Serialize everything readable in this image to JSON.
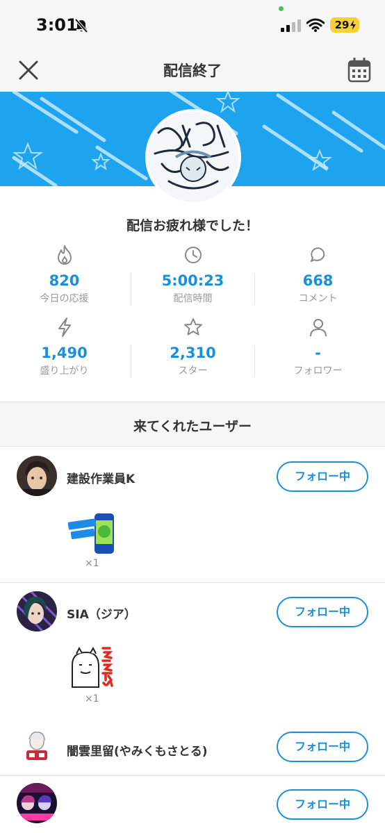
{
  "status_bar": {
    "time": "3:01",
    "battery": "29"
  },
  "nav": {
    "title": "配信終了"
  },
  "summary": {
    "greeting": "配信お疲れ様でした！"
  },
  "stats": [
    {
      "icon": "fire-icon",
      "value": "820",
      "label": "今日の応援"
    },
    {
      "icon": "clock-icon",
      "value": "5:00:23",
      "label": "配信時間"
    },
    {
      "icon": "comment-icon",
      "value": "668",
      "label": "コメント"
    },
    {
      "icon": "lightning-icon",
      "value": "1,490",
      "label": "盛り上がり"
    },
    {
      "icon": "star-icon",
      "value": "2,310",
      "label": "スター"
    },
    {
      "icon": "person-icon",
      "value": "-",
      "label": "フォロワー"
    }
  ],
  "visitors": {
    "title": "来てくれたユーザー",
    "users": [
      {
        "name": "建設作業員K",
        "follow_label": "フォロー中",
        "gift_count": "×1",
        "gift_icon": "energy-drink-can-icon"
      },
      {
        "name": "SIA（ジア）",
        "follow_label": "フォロー中",
        "gift_count": "×1",
        "gift_icon": "eeyan-sticker-icon"
      },
      {
        "name": "闇雲里留(やみくもさとる)",
        "follow_label": "フォロー中"
      },
      {
        "name": "",
        "follow_label": "フォロー中"
      }
    ]
  },
  "colors": {
    "accent": "#1a8fdc",
    "banner": "#1ea4ee",
    "header_bg": "#f6f6f6",
    "battery": "#f7cf36"
  }
}
